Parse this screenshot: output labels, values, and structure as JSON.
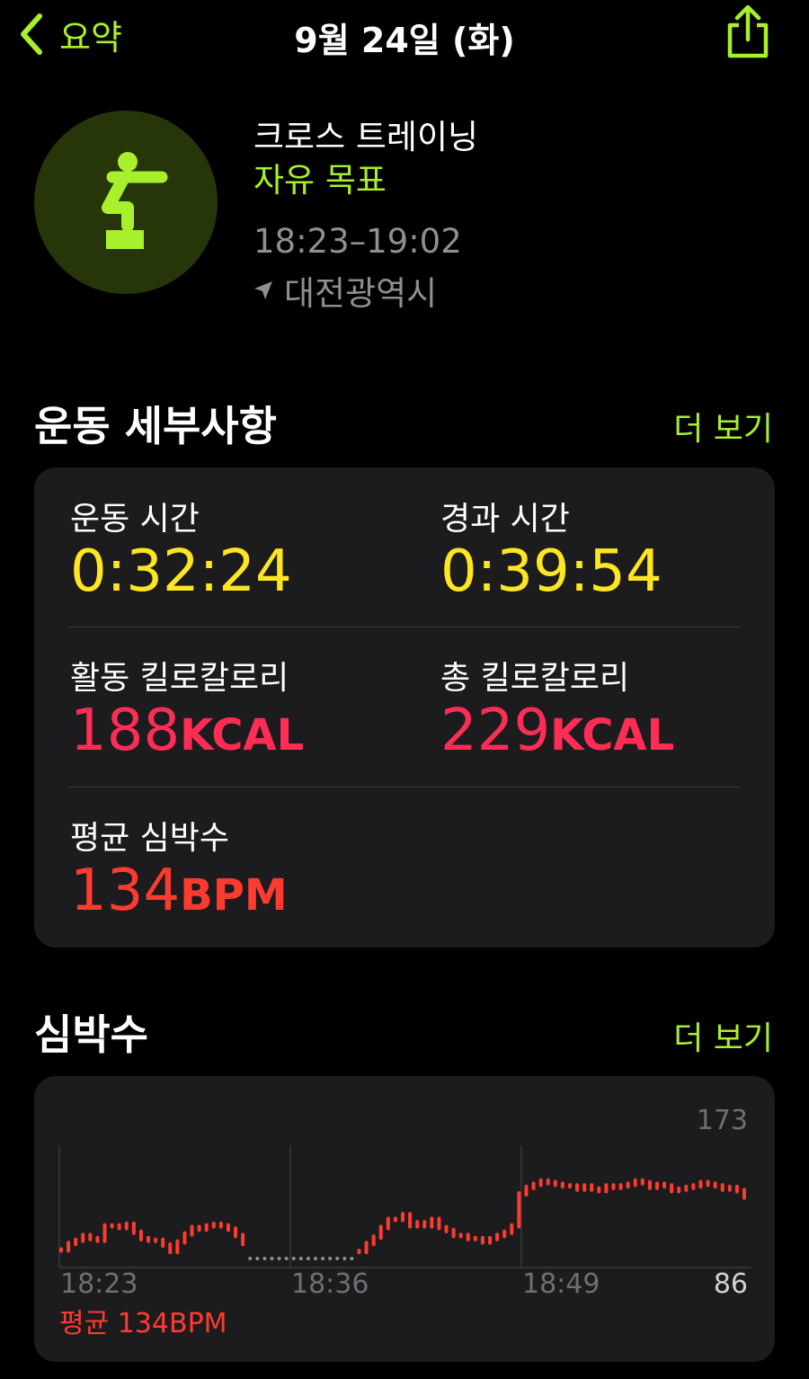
{
  "nav": {
    "back_label": "요약",
    "title": "9월 24일 (화)"
  },
  "workout": {
    "name": "크로스 트레이닝",
    "goal": "자유 목표",
    "time_range": "18:23–19:02",
    "location": "대전광역시",
    "icon": "cross-training-figure-icon"
  },
  "details": {
    "title": "운동 세부사항",
    "more": "더 보기",
    "workout_time": {
      "label": "운동 시간",
      "value": "0:32:24"
    },
    "elapsed_time": {
      "label": "경과 시간",
      "value": "0:39:54"
    },
    "active_kcal": {
      "label": "활동 킬로칼로리",
      "value": "188",
      "unit": "KCAL"
    },
    "total_kcal": {
      "label": "총 킬로칼로리",
      "value": "229",
      "unit": "KCAL"
    },
    "avg_hr": {
      "label": "평균 심박수",
      "value": "134",
      "unit": "BPM"
    }
  },
  "heart_rate": {
    "title": "심박수",
    "more": "더 보기",
    "max_label": "173",
    "min_label": "86",
    "avg_label": "평균 134BPM",
    "x_labels": [
      "18:23",
      "18:36",
      "18:49"
    ]
  },
  "colors": {
    "accent": "#a8f02b",
    "yellow": "#ffe620",
    "pink": "#ff2d55",
    "red": "#ff3b30",
    "card": "#1c1c1e"
  },
  "chart_data": {
    "type": "bar",
    "title": "심박수",
    "ylim": [
      86,
      173
    ],
    "x_range": [
      "18:23",
      "19:02"
    ],
    "values": [
      97,
      101,
      103,
      106,
      104,
      103,
      112,
      112,
      111,
      113,
      108,
      104,
      103,
      103,
      100,
      96,
      102,
      107,
      111,
      110,
      112,
      113,
      112,
      110,
      106,
      101,
      null,
      null,
      null,
      null,
      null,
      null,
      null,
      null,
      null,
      null,
      null,
      null,
      null,
      null,
      null,
      96,
      101,
      105,
      111,
      116,
      116,
      119,
      112,
      114,
      112,
      116,
      111,
      109,
      106,
      106,
      104,
      104,
      102,
      104,
      106,
      108,
      112,
      132,
      136,
      138,
      140,
      139,
      138,
      137,
      137,
      135,
      137,
      135,
      134,
      137,
      136,
      137,
      138,
      140,
      139,
      136,
      138,
      137,
      134,
      135,
      136,
      137,
      139,
      138,
      137,
      135,
      136,
      134,
      130
    ]
  }
}
